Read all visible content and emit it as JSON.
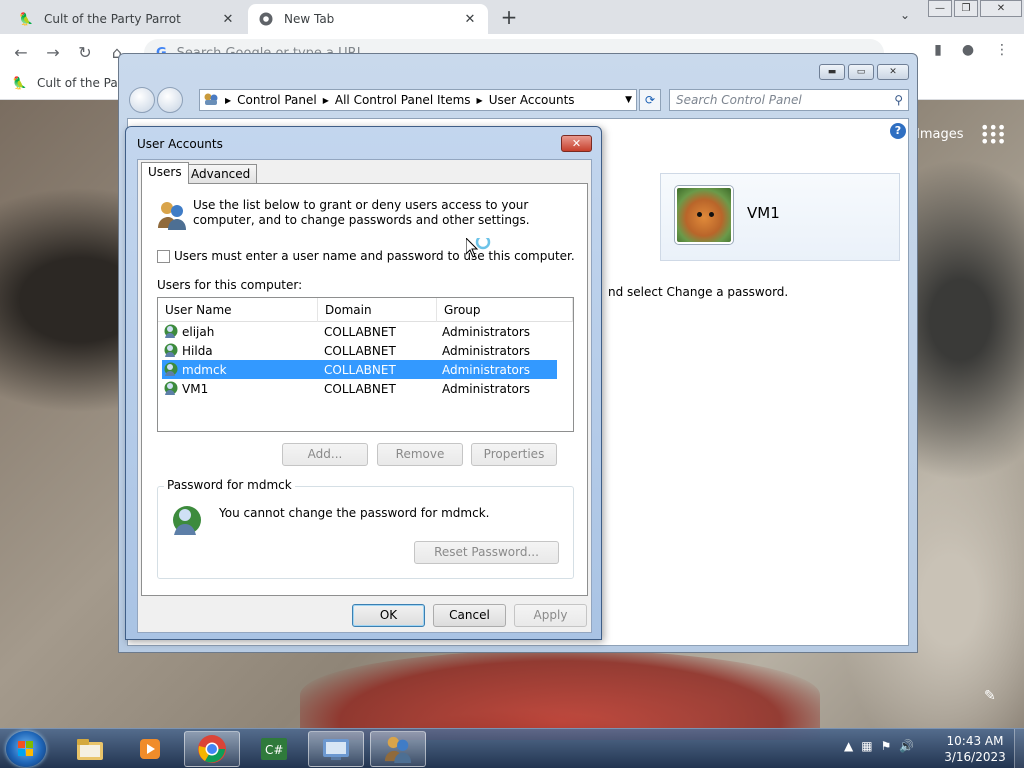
{
  "browser": {
    "tabs": [
      {
        "label": "Cult of the Party Parrot",
        "close": "✕"
      },
      {
        "label": "New Tab",
        "close": "✕"
      }
    ],
    "new_tab": "+",
    "tab_search": "⌄",
    "omnibox_placeholder": "Search Google or type a URL",
    "omnibox_g": "G",
    "bookmark": "Cult of the Part",
    "ntp_images": "Images",
    "ntp_edit": "✎",
    "win_controls": {
      "minimize": "—",
      "restore": "❐",
      "close": "✕"
    }
  },
  "control_panel": {
    "breadcrumb": [
      "Control Panel",
      "All Control Panel Items",
      "User Accounts"
    ],
    "search_placeholder": "Search Control Panel",
    "search_icon": "⚲",
    "refresh_icon": "⟳",
    "help": "?",
    "account_name": "VM1",
    "hint_text": "nd select Change a password.",
    "caption": {
      "minimize": "▬",
      "maximize": "▭",
      "close": "✕"
    }
  },
  "user_accounts_dialog": {
    "title": "User Accounts",
    "close": "✕",
    "tabs": [
      "Users",
      "Advanced"
    ],
    "intro": "Use the list below to grant or deny users access to your computer, and to change passwords and other settings.",
    "require_password_label": "Users must enter a user name and password to use this computer.",
    "require_password_checked": false,
    "users_label": "Users for this computer:",
    "columns": [
      "User Name",
      "Domain",
      "Group"
    ],
    "rows": [
      {
        "user": "elijah",
        "domain": "COLLABNET",
        "group": "Administrators",
        "selected": false
      },
      {
        "user": "Hilda",
        "domain": "COLLABNET",
        "group": "Administrators",
        "selected": false
      },
      {
        "user": "mdmck",
        "domain": "COLLABNET",
        "group": "Administrators",
        "selected": true
      },
      {
        "user": "VM1",
        "domain": "COLLABNET",
        "group": "Administrators",
        "selected": false
      }
    ],
    "buttons": {
      "add": "Add...",
      "remove": "Remove",
      "properties": "Properties"
    },
    "password_group_title": "Password for mdmck",
    "password_message": "You cannot change the password for mdmck.",
    "reset_password": "Reset Password...",
    "footer": {
      "ok": "OK",
      "cancel": "Cancel",
      "apply": "Apply"
    }
  },
  "taskbar": {
    "time": "10:43 AM",
    "date": "3/16/2023",
    "tray_arrow": "▲"
  },
  "colors": {
    "selection": "#3399ff",
    "dialog_frame": "#a9c3e4",
    "taskbar": "#1e3250"
  }
}
